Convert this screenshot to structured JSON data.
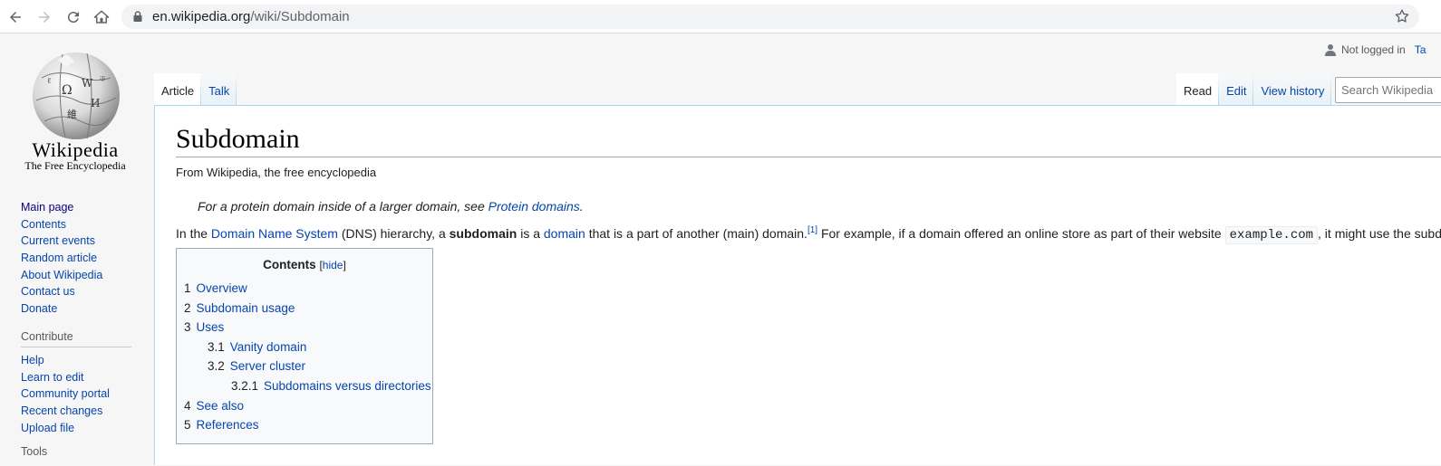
{
  "browser": {
    "url_domain": "en.wikipedia.org",
    "url_path": "/wiki/Subdomain"
  },
  "logo": {
    "wordmark": "Wikipedia",
    "tagline": "The Free Encyclopedia"
  },
  "sidebar": {
    "navigation": [
      "Main page",
      "Contents",
      "Current events",
      "Random article",
      "About Wikipedia",
      "Contact us",
      "Donate"
    ],
    "contribute_heading": "Contribute",
    "contribute": [
      "Help",
      "Learn to edit",
      "Community portal",
      "Recent changes",
      "Upload file"
    ],
    "tools_heading": "Tools"
  },
  "personal": {
    "not_logged_in": "Not logged in",
    "talk": "Ta"
  },
  "tabs": {
    "article": "Article",
    "talk": "Talk",
    "read": "Read",
    "edit": "Edit",
    "view_history": "View history"
  },
  "search": {
    "placeholder": "Search Wikipedia"
  },
  "article": {
    "title": "Subdomain",
    "tagline": "From Wikipedia, the free encyclopedia",
    "hatnote_prefix": "For a protein domain inside of a larger domain, see ",
    "hatnote_link": "Protein domains",
    "hatnote_suffix": ".",
    "p1_a": "In the ",
    "p1_link1": "Domain Name System",
    "p1_b": " (DNS) hierarchy, a ",
    "p1_bold": "subdomain",
    "p1_c": " is a ",
    "p1_link2": "domain",
    "p1_d": " that is a part of another (main) domain.",
    "p1_ref": "[1]",
    "p1_e": " For example, if a domain offered an online store as part of their website ",
    "p1_code": "example.com",
    "p1_f": ", it might use the subdomain"
  },
  "toc": {
    "title": "Contents",
    "hide_open": "[",
    "hide": "hide",
    "hide_close": "]",
    "items": [
      {
        "num": "1",
        "label": "Overview",
        "level": 1
      },
      {
        "num": "2",
        "label": "Subdomain usage",
        "level": 1
      },
      {
        "num": "3",
        "label": "Uses",
        "level": 1
      },
      {
        "num": "3.1",
        "label": "Vanity domain",
        "level": 2
      },
      {
        "num": "3.2",
        "label": "Server cluster",
        "level": 2
      },
      {
        "num": "3.2.1",
        "label": "Subdomains versus directories",
        "level": 3
      },
      {
        "num": "4",
        "label": "See also",
        "level": 1
      },
      {
        "num": "5",
        "label": "References",
        "level": 1
      }
    ]
  }
}
